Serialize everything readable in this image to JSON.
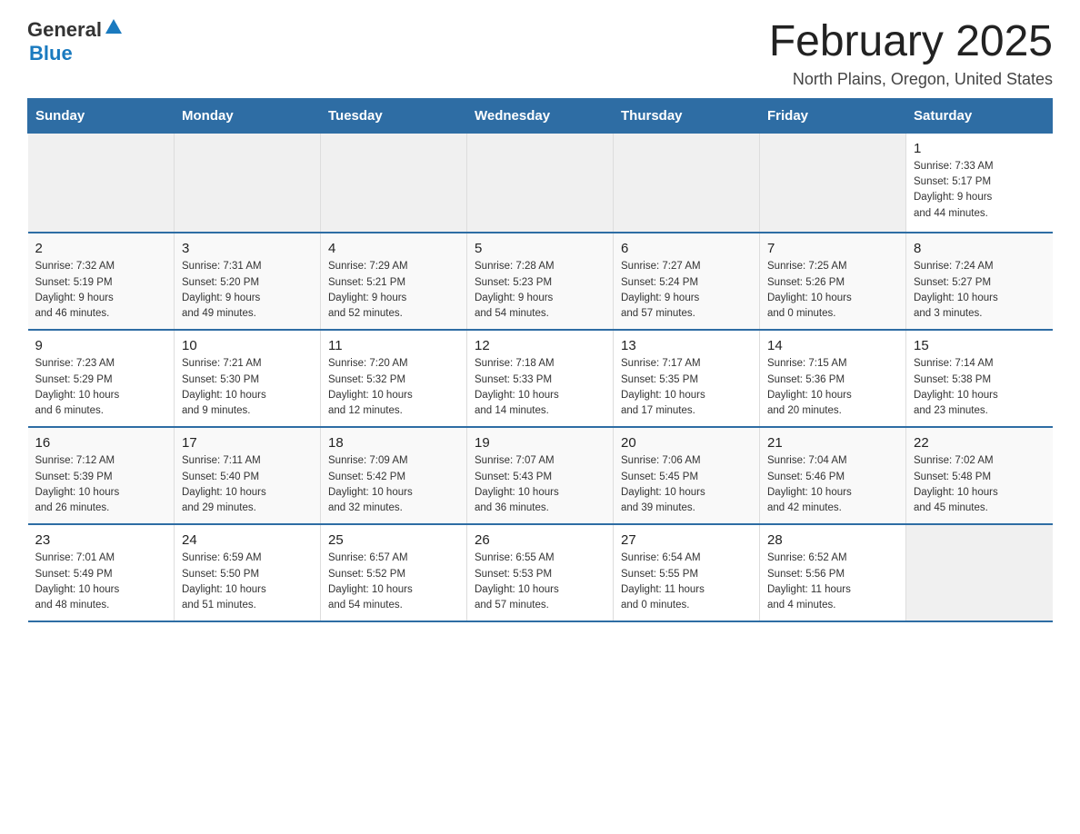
{
  "logo": {
    "text_general": "General",
    "triangle_symbol": "▲",
    "text_blue": "Blue"
  },
  "header": {
    "month_title": "February 2025",
    "location": "North Plains, Oregon, United States"
  },
  "weekdays": [
    "Sunday",
    "Monday",
    "Tuesday",
    "Wednesday",
    "Thursday",
    "Friday",
    "Saturday"
  ],
  "weeks": [
    [
      {
        "day": "",
        "info": ""
      },
      {
        "day": "",
        "info": ""
      },
      {
        "day": "",
        "info": ""
      },
      {
        "day": "",
        "info": ""
      },
      {
        "day": "",
        "info": ""
      },
      {
        "day": "",
        "info": ""
      },
      {
        "day": "1",
        "info": "Sunrise: 7:33 AM\nSunset: 5:17 PM\nDaylight: 9 hours\nand 44 minutes."
      }
    ],
    [
      {
        "day": "2",
        "info": "Sunrise: 7:32 AM\nSunset: 5:19 PM\nDaylight: 9 hours\nand 46 minutes."
      },
      {
        "day": "3",
        "info": "Sunrise: 7:31 AM\nSunset: 5:20 PM\nDaylight: 9 hours\nand 49 minutes."
      },
      {
        "day": "4",
        "info": "Sunrise: 7:29 AM\nSunset: 5:21 PM\nDaylight: 9 hours\nand 52 minutes."
      },
      {
        "day": "5",
        "info": "Sunrise: 7:28 AM\nSunset: 5:23 PM\nDaylight: 9 hours\nand 54 minutes."
      },
      {
        "day": "6",
        "info": "Sunrise: 7:27 AM\nSunset: 5:24 PM\nDaylight: 9 hours\nand 57 minutes."
      },
      {
        "day": "7",
        "info": "Sunrise: 7:25 AM\nSunset: 5:26 PM\nDaylight: 10 hours\nand 0 minutes."
      },
      {
        "day": "8",
        "info": "Sunrise: 7:24 AM\nSunset: 5:27 PM\nDaylight: 10 hours\nand 3 minutes."
      }
    ],
    [
      {
        "day": "9",
        "info": "Sunrise: 7:23 AM\nSunset: 5:29 PM\nDaylight: 10 hours\nand 6 minutes."
      },
      {
        "day": "10",
        "info": "Sunrise: 7:21 AM\nSunset: 5:30 PM\nDaylight: 10 hours\nand 9 minutes."
      },
      {
        "day": "11",
        "info": "Sunrise: 7:20 AM\nSunset: 5:32 PM\nDaylight: 10 hours\nand 12 minutes."
      },
      {
        "day": "12",
        "info": "Sunrise: 7:18 AM\nSunset: 5:33 PM\nDaylight: 10 hours\nand 14 minutes."
      },
      {
        "day": "13",
        "info": "Sunrise: 7:17 AM\nSunset: 5:35 PM\nDaylight: 10 hours\nand 17 minutes."
      },
      {
        "day": "14",
        "info": "Sunrise: 7:15 AM\nSunset: 5:36 PM\nDaylight: 10 hours\nand 20 minutes."
      },
      {
        "day": "15",
        "info": "Sunrise: 7:14 AM\nSunset: 5:38 PM\nDaylight: 10 hours\nand 23 minutes."
      }
    ],
    [
      {
        "day": "16",
        "info": "Sunrise: 7:12 AM\nSunset: 5:39 PM\nDaylight: 10 hours\nand 26 minutes."
      },
      {
        "day": "17",
        "info": "Sunrise: 7:11 AM\nSunset: 5:40 PM\nDaylight: 10 hours\nand 29 minutes."
      },
      {
        "day": "18",
        "info": "Sunrise: 7:09 AM\nSunset: 5:42 PM\nDaylight: 10 hours\nand 32 minutes."
      },
      {
        "day": "19",
        "info": "Sunrise: 7:07 AM\nSunset: 5:43 PM\nDaylight: 10 hours\nand 36 minutes."
      },
      {
        "day": "20",
        "info": "Sunrise: 7:06 AM\nSunset: 5:45 PM\nDaylight: 10 hours\nand 39 minutes."
      },
      {
        "day": "21",
        "info": "Sunrise: 7:04 AM\nSunset: 5:46 PM\nDaylight: 10 hours\nand 42 minutes."
      },
      {
        "day": "22",
        "info": "Sunrise: 7:02 AM\nSunset: 5:48 PM\nDaylight: 10 hours\nand 45 minutes."
      }
    ],
    [
      {
        "day": "23",
        "info": "Sunrise: 7:01 AM\nSunset: 5:49 PM\nDaylight: 10 hours\nand 48 minutes."
      },
      {
        "day": "24",
        "info": "Sunrise: 6:59 AM\nSunset: 5:50 PM\nDaylight: 10 hours\nand 51 minutes."
      },
      {
        "day": "25",
        "info": "Sunrise: 6:57 AM\nSunset: 5:52 PM\nDaylight: 10 hours\nand 54 minutes."
      },
      {
        "day": "26",
        "info": "Sunrise: 6:55 AM\nSunset: 5:53 PM\nDaylight: 10 hours\nand 57 minutes."
      },
      {
        "day": "27",
        "info": "Sunrise: 6:54 AM\nSunset: 5:55 PM\nDaylight: 11 hours\nand 0 minutes."
      },
      {
        "day": "28",
        "info": "Sunrise: 6:52 AM\nSunset: 5:56 PM\nDaylight: 11 hours\nand 4 minutes."
      },
      {
        "day": "",
        "info": ""
      }
    ]
  ]
}
